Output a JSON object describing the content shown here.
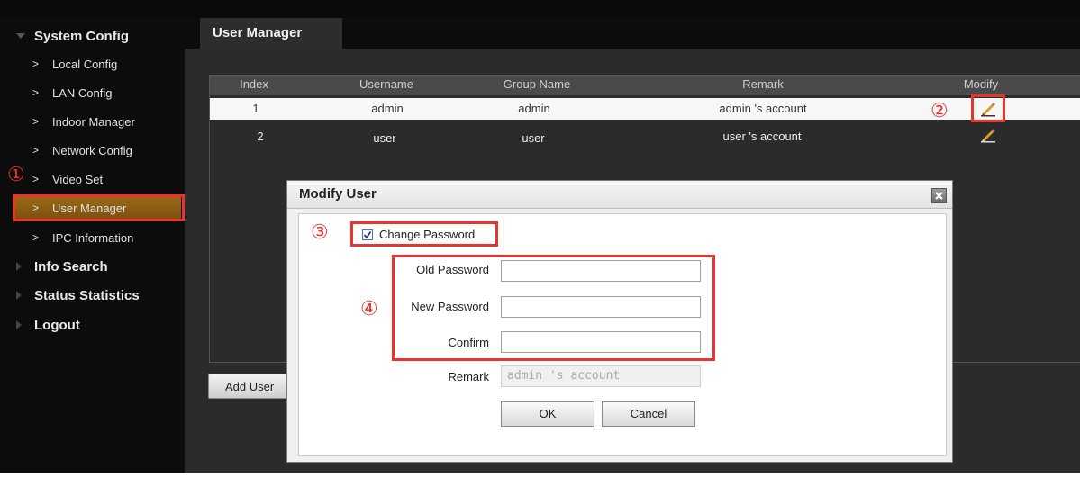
{
  "sidebar": {
    "section_system": "System Config",
    "items": [
      {
        "label": "Local Config"
      },
      {
        "label": "LAN Config"
      },
      {
        "label": "Indoor Manager"
      },
      {
        "label": "Network Config"
      },
      {
        "label": "Video Set"
      },
      {
        "label": "User Manager",
        "active": true
      },
      {
        "label": "IPC Information"
      }
    ],
    "section_info": "Info Search",
    "section_status": "Status Statistics",
    "section_logout": "Logout"
  },
  "tab": {
    "label": "User Manager"
  },
  "table": {
    "headers": [
      "Index",
      "Username",
      "Group Name",
      "Remark",
      "Modify"
    ],
    "rows": [
      {
        "index": "1",
        "username": "admin",
        "group": "admin",
        "remark": "admin 's account",
        "icon": "pencil-icon"
      },
      {
        "index": "2",
        "username": "user",
        "group": "user",
        "remark": "user 's account",
        "icon": "pencil-icon"
      }
    ]
  },
  "add_user_button": "Add User",
  "modal": {
    "title": "Modify User",
    "change_password_label": "Change Password",
    "change_password_checked": true,
    "old_password_label": "Old Password",
    "old_password_value": "",
    "new_password_label": "New Password",
    "new_password_value": "",
    "confirm_label": "Confirm",
    "confirm_value": "",
    "remark_label": "Remark",
    "remark_value": "admin 's account",
    "ok": "OK",
    "cancel": "Cancel"
  },
  "annotations": {
    "one": "①",
    "two": "②",
    "three": "③",
    "four": "④"
  },
  "colors": {
    "highlight": "#e8342c",
    "active_nav": "#8a5d14",
    "selected_row": "#f7f7f7"
  }
}
